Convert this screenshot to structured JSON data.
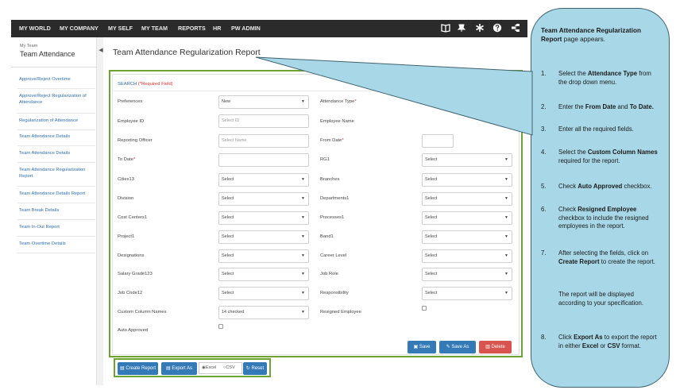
{
  "topnav": {
    "items": [
      "MY WORLD",
      "MY COMPANY",
      "MY SELF",
      "MY TEAM",
      "REPORTS",
      "HR",
      "PW ADMIN"
    ],
    "icons": [
      "book-icon",
      "pin-icon",
      "star-icon",
      "help-icon",
      "sitemap-icon"
    ]
  },
  "sidebar": {
    "breadcrumb": "My Team",
    "title": "Team Attendance",
    "items": [
      "Approve/Reject Overtime",
      "Approve/Reject Regularization of Attendance",
      "Regularization of Attendance",
      "Team Attendance Details",
      "Team Attendance Details",
      "Team Attendance Regularization Report",
      "Team Attendance Details Report",
      "Team Break Details",
      "Team In-Out Report",
      "Team Overtime Details"
    ]
  },
  "main": {
    "title": "Team Attendance Regularization Report",
    "search_label": "SEARCH",
    "required_note": "(*Required Field)"
  },
  "form": {
    "preferences": {
      "label": "Preferences",
      "value": "New"
    },
    "attendance_type": {
      "label": "Attendance Type",
      "value": ""
    },
    "employee_id": {
      "label": "Employee ID",
      "placeholder": "Select ID"
    },
    "employee_name": {
      "label": "Employee Name"
    },
    "reporting_officer": {
      "label": "Reporting Officer",
      "placeholder": "Select Name"
    },
    "from_date": {
      "label": "From Date",
      "value": ""
    },
    "to_date": {
      "label": "To Date",
      "value": ""
    },
    "rg1": {
      "label": "RG1",
      "value": "Select"
    },
    "cities13": {
      "label": "Cities13",
      "value": "Select"
    },
    "branches": {
      "label": "Branches",
      "value": "Select"
    },
    "division": {
      "label": "Division",
      "value": "Select"
    },
    "departments1": {
      "label": "Departments1",
      "value": "Select"
    },
    "cost_centers1": {
      "label": "Cost Centers1",
      "value": "Select"
    },
    "processes1": {
      "label": "Processes1",
      "value": "Select"
    },
    "project1": {
      "label": "Project1",
      "value": "Select"
    },
    "band1": {
      "label": "Band1",
      "value": "Select"
    },
    "designations": {
      "label": "Designations",
      "value": "Select"
    },
    "career_level": {
      "label": "Career Level",
      "value": "Select"
    },
    "salary_grade123": {
      "label": "Salary Grade123",
      "value": "Select"
    },
    "job_role": {
      "label": "Job Role",
      "value": "Select"
    },
    "job_code12": {
      "label": "Job Code12",
      "value": "Select"
    },
    "responsibility": {
      "label": "Responsibility",
      "value": "Select"
    },
    "custom_columns": {
      "label": "Custom Column Names",
      "value": "14 checked"
    },
    "resigned_employee": {
      "label": "Resigned Employee"
    },
    "auto_approved": {
      "label": "Auto Approved"
    }
  },
  "actions": {
    "save": "Save",
    "save_as": "Save As",
    "delete": "Delete",
    "create_report": "Create Report",
    "export_as": "Export As",
    "excel": "Excel",
    "csv": "CSV",
    "reset": "Reset"
  },
  "callout": {
    "intro_bold": "Team Attendance Regularization Report",
    "intro_rest": " page appears.",
    "steps": [
      {
        "num": "1.",
        "html": "Select the <b>Attendance Type</b> from the drop down menu."
      },
      {
        "num": "2.",
        "html": "Enter the <b>From Date</b> and <b>To Date.</b>"
      },
      {
        "num": "3.",
        "html": "Enter all the required fields."
      },
      {
        "num": "4.",
        "html": "Select the <b>Custom Column Names</b> required for the report."
      },
      {
        "num": "5.",
        "html": "Check <b>Auto Approved</b> checkbox."
      },
      {
        "num": "6.",
        "html": "Check <b>Resigned Employee</b> checkbox to include the resigned employees in the report."
      },
      {
        "num": "7.",
        "html": "After selecting the fields, click on <b>Create Report</b> to create the report."
      },
      {
        "num": "8.",
        "html": "Click <b>Export As</b> to export the report in either <b>Excel</b> or <b>CSV</b> format."
      }
    ],
    "note": "The report will be displayed according to your specification."
  },
  "colors": {
    "nav_bg": "#2b2b2b",
    "link": "#2f6fb0",
    "highlight_frame": "#6da332",
    "button_blue": "#337ab7",
    "button_red": "#d9534f",
    "callout_bg": "#a8d8e8"
  }
}
